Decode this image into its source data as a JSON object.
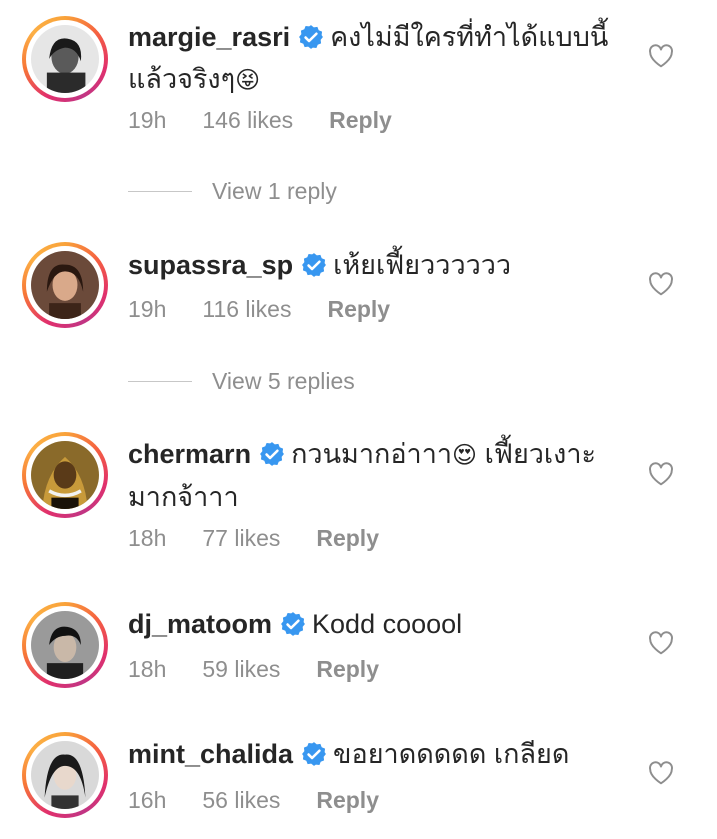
{
  "comments": [
    {
      "username": "margie_rasri",
      "text_line1": "คงไม่มีใครที่ทำได้แบบนี้",
      "text_line2": "แล้วจริงๆ",
      "emoji": "😝",
      "time": "19h",
      "likes": "146 likes",
      "reply": "Reply",
      "view_replies": "View 1 reply"
    },
    {
      "username": "supassra_sp",
      "text_line1": "เห้ยเฟี้ยวววววว",
      "time": "19h",
      "likes": "116 likes",
      "reply": "Reply",
      "view_replies": "View 5 replies"
    },
    {
      "username": "chermarn",
      "text_line1": "กวนมากอ่าาา",
      "emoji": "😍",
      "text_line1b": "เฟี้ยวเงาะ",
      "text_line2": "มากจ้าาา",
      "time": "18h",
      "likes": "77 likes",
      "reply": "Reply"
    },
    {
      "username": "dj_matoom",
      "text_line1": "Kodd cooool",
      "time": "18h",
      "likes": "59 likes",
      "reply": "Reply"
    },
    {
      "username": "mint_chalida",
      "text_line1": "ขอยาดดดดด เกลียด",
      "time": "16h",
      "likes": "56 likes",
      "reply": "Reply"
    }
  ],
  "colors": {
    "verified": "#3897f0",
    "meta": "#8e8e8e",
    "text": "#262626"
  },
  "icons": [
    "verified-badge-icon",
    "heart-icon"
  ]
}
